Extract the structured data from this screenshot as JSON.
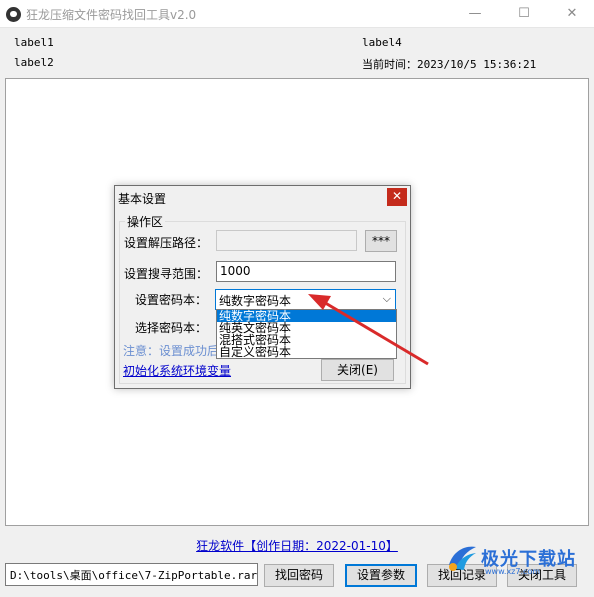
{
  "window": {
    "title": "狂龙压缩文件密码找回工具v2.0",
    "minimize_symbol": "—",
    "maximize_symbol": "☐",
    "close_symbol": "✕"
  },
  "labels": {
    "label1": "label1",
    "label2": "label2",
    "label4": "label4",
    "current_time": "当前时间：2023/10/5 15:36:21"
  },
  "footer": {
    "link_text": "狂龙软件【创作日期：2022-01-10】",
    "path_value": "D:\\tools\\桌面\\office\\7-ZipPortable.rar",
    "buttons": {
      "recover": "找回密码",
      "settings": "设置参数",
      "history": "找回记录",
      "close": "关闭工具"
    }
  },
  "dialog": {
    "title": "基本设置",
    "close_symbol": "✕",
    "group_title": "操作区",
    "extract_path_label": "设置解压路径：",
    "extract_path_value": "",
    "browse_button": "***",
    "search_range_label": "设置搜寻范围：",
    "search_range_value": "1000",
    "dictionary_label": "设置密码本：",
    "dictionary_selected": "纯数字密码本",
    "dictionary_options": [
      "纯数字密码本",
      "纯英文密码本",
      "混搭式密码本",
      "自定义密码本"
    ],
    "select_dictionary_label": "选择密码本：",
    "note_text": "注意：设置成功后",
    "init_link": "初始化系统环境变量",
    "close_button": "关闭(E)"
  },
  "watermark": {
    "text": "极光下载站",
    "sub": "www.xz7.com"
  },
  "colors": {
    "accent": "#0078d7",
    "annotation_arrow": "#d92a2a",
    "link": "#0000cc"
  }
}
